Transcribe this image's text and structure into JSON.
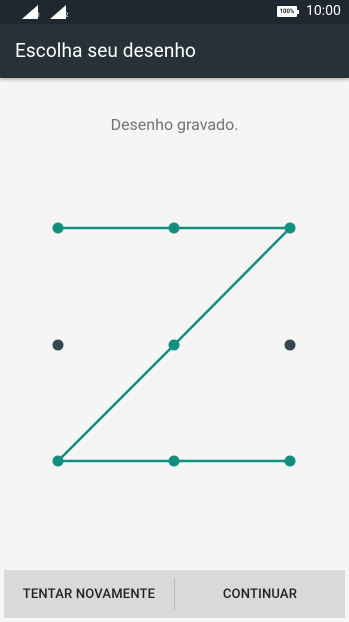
{
  "status_bar": {
    "sim1_label": "1",
    "sim2_label": "2",
    "battery_label": "100%",
    "time": "10:00"
  },
  "app_bar": {
    "title": "Escolha seu desenho"
  },
  "message": "Desenho gravado.",
  "pattern": {
    "grid": [
      [
        "row1-col1",
        "row1-col2",
        "row1-col3"
      ],
      [
        "row2-col1",
        "row2-col2",
        "row2-col3"
      ],
      [
        "row3-col1",
        "row3-col2",
        "row3-col3"
      ]
    ],
    "selected_sequence": [
      1,
      2,
      3,
      5,
      7,
      8,
      9
    ],
    "line_color": "#138f80",
    "dot_selected_color": "#138f80",
    "dot_unselected_color": "#37474f"
  },
  "buttons": {
    "retry": "TENTAR NOVAMENTE",
    "continue": "CONTINUAR"
  }
}
